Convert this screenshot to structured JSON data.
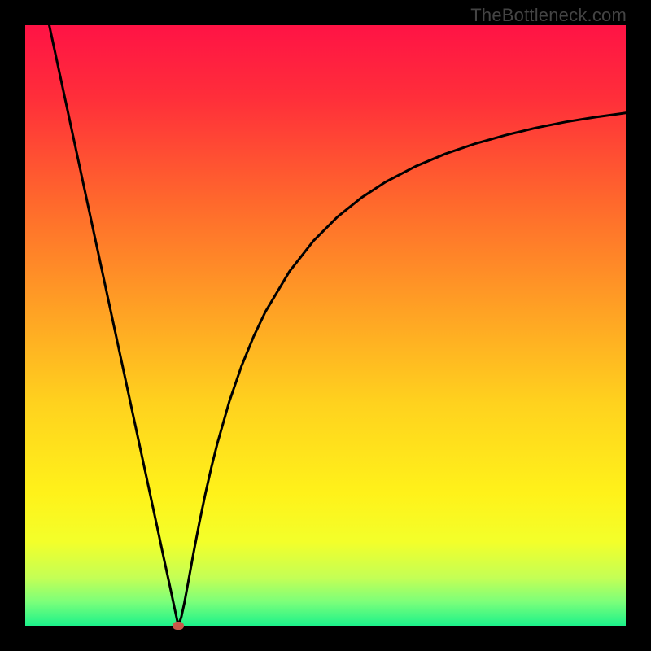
{
  "watermark": "TheBottleneck.com",
  "chart_data": {
    "type": "line",
    "title": "",
    "xlabel": "",
    "ylabel": "",
    "xlim": [
      0,
      100
    ],
    "ylim": [
      0,
      100
    ],
    "grid": false,
    "gradient_stops": [
      {
        "offset": 0.0,
        "color": "#ff1345"
      },
      {
        "offset": 0.12,
        "color": "#ff2e3a"
      },
      {
        "offset": 0.3,
        "color": "#ff6a2c"
      },
      {
        "offset": 0.48,
        "color": "#ffa324"
      },
      {
        "offset": 0.63,
        "color": "#ffd21e"
      },
      {
        "offset": 0.78,
        "color": "#fff21a"
      },
      {
        "offset": 0.86,
        "color": "#f3ff2a"
      },
      {
        "offset": 0.92,
        "color": "#c4ff55"
      },
      {
        "offset": 0.96,
        "color": "#7cff7a"
      },
      {
        "offset": 1.0,
        "color": "#1cf28a"
      }
    ],
    "series": [
      {
        "name": "bottleneck-curve",
        "color": "#000000",
        "width": 3,
        "x": [
          4.0,
          6.0,
          8.0,
          10.0,
          12.0,
          14.0,
          16.0,
          18.0,
          20.0,
          22.0,
          23.0,
          24.0,
          25.0,
          25.5,
          26.0,
          26.5,
          27.0,
          28.0,
          29.0,
          30.0,
          31.0,
          32.0,
          34.0,
          36.0,
          38.0,
          40.0,
          44.0,
          48.0,
          52.0,
          56.0,
          60.0,
          65.0,
          70.0,
          75.0,
          80.0,
          85.0,
          90.0,
          95.0,
          100.0
        ],
        "y": [
          100.0,
          90.7,
          81.4,
          72.1,
          62.8,
          53.5,
          44.2,
          34.9,
          25.6,
          16.3,
          11.6,
          7.0,
          2.3,
          0.0,
          1.5,
          3.8,
          6.5,
          12.0,
          17.2,
          22.0,
          26.4,
          30.4,
          37.4,
          43.2,
          48.1,
          52.3,
          59.0,
          64.1,
          68.1,
          71.3,
          73.9,
          76.5,
          78.6,
          80.3,
          81.7,
          82.9,
          83.9,
          84.7,
          85.4
        ]
      }
    ],
    "marker": {
      "name": "optimal-point",
      "x": 25.5,
      "y": 0.0,
      "color": "#c9594a"
    }
  }
}
